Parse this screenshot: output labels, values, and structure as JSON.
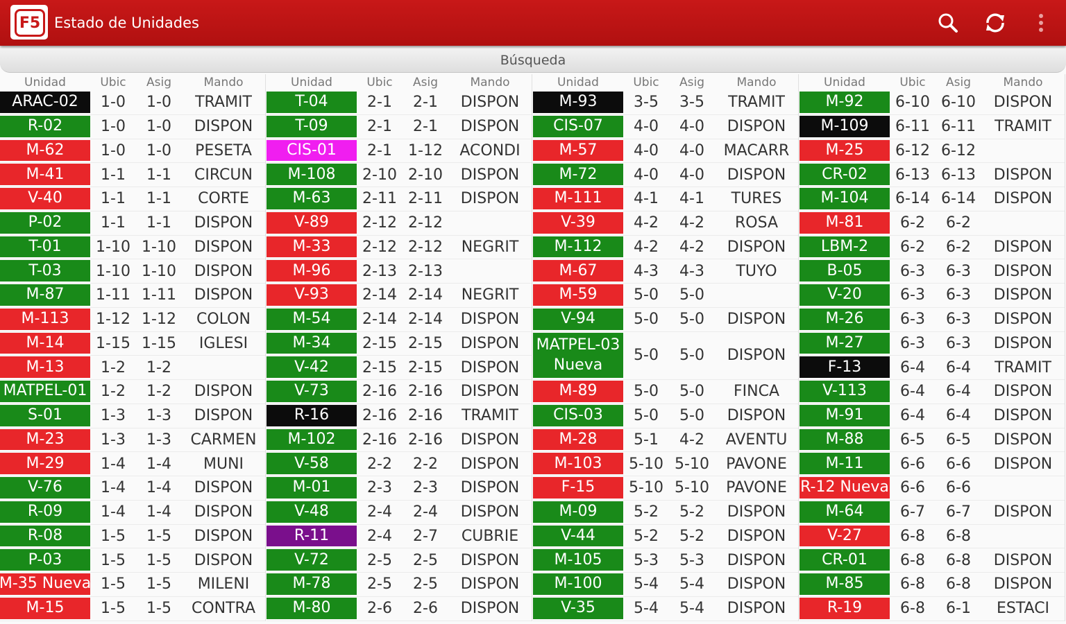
{
  "appbar": {
    "logo_text": "F5",
    "title": "Estado de Unidades",
    "icons": [
      "search-icon",
      "refresh-icon",
      "more-vert-icon"
    ]
  },
  "search": {
    "label": "Búsqueda"
  },
  "colors": {
    "green": "#198a19",
    "red": "#e8262a",
    "black": "#0c0c0c",
    "magenta": "#f01ef0",
    "purple": "#7a0f8c",
    "appbar": "#c81818"
  },
  "headers": {
    "unit": "Unidad",
    "ubic": "Ubic",
    "asig": "Asig",
    "mando": "Mando"
  },
  "columns": [
    [
      {
        "unit": "ARAC-02",
        "status": "black",
        "ubic": "1-0",
        "asig": "1-0",
        "mando": "TRAMIT"
      },
      {
        "unit": "R-02",
        "status": "green",
        "ubic": "1-0",
        "asig": "1-0",
        "mando": "DISPON"
      },
      {
        "unit": "M-62",
        "status": "red",
        "ubic": "1-0",
        "asig": "1-0",
        "mando": "PESETA"
      },
      {
        "unit": "M-41",
        "status": "red",
        "ubic": "1-1",
        "asig": "1-1",
        "mando": "CIRCUN"
      },
      {
        "unit": "V-40",
        "status": "red",
        "ubic": "1-1",
        "asig": "1-1",
        "mando": "CORTE"
      },
      {
        "unit": "P-02",
        "status": "green",
        "ubic": "1-1",
        "asig": "1-1",
        "mando": "DISPON"
      },
      {
        "unit": "T-01",
        "status": "green",
        "ubic": "1-10",
        "asig": "1-10",
        "mando": "DISPON"
      },
      {
        "unit": "T-03",
        "status": "green",
        "ubic": "1-10",
        "asig": "1-10",
        "mando": "DISPON"
      },
      {
        "unit": "M-87",
        "status": "green",
        "ubic": "1-11",
        "asig": "1-11",
        "mando": "DISPON"
      },
      {
        "unit": "M-113",
        "status": "red",
        "ubic": "1-12",
        "asig": "1-12",
        "mando": "COLON"
      },
      {
        "unit": "M-14",
        "status": "red",
        "ubic": "1-15",
        "asig": "1-15",
        "mando": "IGLESI"
      },
      {
        "unit": "M-13",
        "status": "red",
        "ubic": "1-2",
        "asig": "1-2",
        "mando": ""
      },
      {
        "unit": "MATPEL-01",
        "status": "green",
        "ubic": "1-2",
        "asig": "1-2",
        "mando": "DISPON"
      },
      {
        "unit": "S-01",
        "status": "green",
        "ubic": "1-3",
        "asig": "1-3",
        "mando": "DISPON"
      },
      {
        "unit": "M-23",
        "status": "red",
        "ubic": "1-3",
        "asig": "1-3",
        "mando": "CARMEN"
      },
      {
        "unit": "M-29",
        "status": "red",
        "ubic": "1-4",
        "asig": "1-4",
        "mando": "MUNI"
      },
      {
        "unit": "V-76",
        "status": "green",
        "ubic": "1-4",
        "asig": "1-4",
        "mando": "DISPON"
      },
      {
        "unit": "R-09",
        "status": "green",
        "ubic": "1-4",
        "asig": "1-4",
        "mando": "DISPON"
      },
      {
        "unit": "R-08",
        "status": "green",
        "ubic": "1-5",
        "asig": "1-5",
        "mando": "DISPON"
      },
      {
        "unit": "P-03",
        "status": "green",
        "ubic": "1-5",
        "asig": "1-5",
        "mando": "DISPON"
      },
      {
        "unit": "M-35 Nueva",
        "status": "red",
        "ubic": "1-5",
        "asig": "1-5",
        "mando": "MILENI"
      },
      {
        "unit": "M-15",
        "status": "red",
        "ubic": "1-5",
        "asig": "1-5",
        "mando": "CONTRA"
      }
    ],
    [
      {
        "unit": "T-04",
        "status": "green",
        "ubic": "2-1",
        "asig": "2-1",
        "mando": "DISPON"
      },
      {
        "unit": "T-09",
        "status": "green",
        "ubic": "2-1",
        "asig": "2-1",
        "mando": "DISPON"
      },
      {
        "unit": "CIS-01",
        "status": "magenta",
        "ubic": "2-1",
        "asig": "1-12",
        "mando": "ACONDI"
      },
      {
        "unit": "M-108",
        "status": "green",
        "ubic": "2-10",
        "asig": "2-10",
        "mando": "DISPON"
      },
      {
        "unit": "M-63",
        "status": "green",
        "ubic": "2-11",
        "asig": "2-11",
        "mando": "DISPON"
      },
      {
        "unit": "V-89",
        "status": "red",
        "ubic": "2-12",
        "asig": "2-12",
        "mando": ""
      },
      {
        "unit": "M-33",
        "status": "red",
        "ubic": "2-12",
        "asig": "2-12",
        "mando": "NEGRIT"
      },
      {
        "unit": "M-96",
        "status": "red",
        "ubic": "2-13",
        "asig": "2-13",
        "mando": ""
      },
      {
        "unit": "V-93",
        "status": "red",
        "ubic": "2-14",
        "asig": "2-14",
        "mando": "NEGRIT"
      },
      {
        "unit": "M-54",
        "status": "green",
        "ubic": "2-14",
        "asig": "2-14",
        "mando": "DISPON"
      },
      {
        "unit": "M-34",
        "status": "green",
        "ubic": "2-15",
        "asig": "2-15",
        "mando": "DISPON"
      },
      {
        "unit": "V-42",
        "status": "green",
        "ubic": "2-15",
        "asig": "2-15",
        "mando": "DISPON"
      },
      {
        "unit": "V-73",
        "status": "green",
        "ubic": "2-16",
        "asig": "2-16",
        "mando": "DISPON"
      },
      {
        "unit": "R-16",
        "status": "black",
        "ubic": "2-16",
        "asig": "2-16",
        "mando": "TRAMIT"
      },
      {
        "unit": "M-102",
        "status": "green",
        "ubic": "2-16",
        "asig": "2-16",
        "mando": "DISPON"
      },
      {
        "unit": "V-58",
        "status": "green",
        "ubic": "2-2",
        "asig": "2-2",
        "mando": "DISPON"
      },
      {
        "unit": "M-01",
        "status": "green",
        "ubic": "2-3",
        "asig": "2-3",
        "mando": "DISPON"
      },
      {
        "unit": "V-48",
        "status": "green",
        "ubic": "2-4",
        "asig": "2-4",
        "mando": "DISPON"
      },
      {
        "unit": "R-11",
        "status": "purple",
        "ubic": "2-4",
        "asig": "2-7",
        "mando": "CUBRIE"
      },
      {
        "unit": "V-72",
        "status": "green",
        "ubic": "2-5",
        "asig": "2-5",
        "mando": "DISPON"
      },
      {
        "unit": "M-78",
        "status": "green",
        "ubic": "2-5",
        "asig": "2-5",
        "mando": "DISPON"
      },
      {
        "unit": "M-80",
        "status": "green",
        "ubic": "2-6",
        "asig": "2-6",
        "mando": "DISPON"
      }
    ],
    [
      {
        "unit": "M-93",
        "status": "black",
        "ubic": "3-5",
        "asig": "3-5",
        "mando": "TRAMIT"
      },
      {
        "unit": "CIS-07",
        "status": "green",
        "ubic": "4-0",
        "asig": "4-0",
        "mando": "DISPON"
      },
      {
        "unit": "M-57",
        "status": "red",
        "ubic": "4-0",
        "asig": "4-0",
        "mando": "MACARR"
      },
      {
        "unit": "M-72",
        "status": "green",
        "ubic": "4-0",
        "asig": "4-0",
        "mando": "DISPON"
      },
      {
        "unit": "M-111",
        "status": "red",
        "ubic": "4-1",
        "asig": "4-1",
        "mando": "TURES"
      },
      {
        "unit": "V-39",
        "status": "red",
        "ubic": "4-2",
        "asig": "4-2",
        "mando": "ROSA"
      },
      {
        "unit": "M-112",
        "status": "green",
        "ubic": "4-2",
        "asig": "4-2",
        "mando": "DISPON"
      },
      {
        "unit": "M-67",
        "status": "red",
        "ubic": "4-3",
        "asig": "4-3",
        "mando": "TUYO"
      },
      {
        "unit": "M-59",
        "status": "red",
        "ubic": "5-0",
        "asig": "5-0",
        "mando": ""
      },
      {
        "unit": "V-94",
        "status": "green",
        "ubic": "5-0",
        "asig": "5-0",
        "mando": "DISPON"
      },
      {
        "unit": "MATPEL-03 Nueva",
        "status": "green",
        "ubic": "5-0",
        "asig": "5-0",
        "mando": "DISPON",
        "tall": true
      },
      {
        "unit": "M-89",
        "status": "red",
        "ubic": "5-0",
        "asig": "5-0",
        "mando": "FINCA"
      },
      {
        "unit": "CIS-03",
        "status": "green",
        "ubic": "5-0",
        "asig": "5-0",
        "mando": "DISPON"
      },
      {
        "unit": "M-28",
        "status": "red",
        "ubic": "5-1",
        "asig": "4-2",
        "mando": "AVENTU"
      },
      {
        "unit": "M-103",
        "status": "red",
        "ubic": "5-10",
        "asig": "5-10",
        "mando": "PAVONE"
      },
      {
        "unit": "F-15",
        "status": "red",
        "ubic": "5-10",
        "asig": "5-10",
        "mando": "PAVONE"
      },
      {
        "unit": "M-09",
        "status": "green",
        "ubic": "5-2",
        "asig": "5-2",
        "mando": "DISPON"
      },
      {
        "unit": "V-44",
        "status": "green",
        "ubic": "5-2",
        "asig": "5-2",
        "mando": "DISPON"
      },
      {
        "unit": "M-105",
        "status": "green",
        "ubic": "5-3",
        "asig": "5-3",
        "mando": "DISPON"
      },
      {
        "unit": "M-100",
        "status": "green",
        "ubic": "5-4",
        "asig": "5-4",
        "mando": "DISPON"
      },
      {
        "unit": "V-35",
        "status": "green",
        "ubic": "5-4",
        "asig": "5-4",
        "mando": "DISPON"
      }
    ],
    [
      {
        "unit": "M-92",
        "status": "green",
        "ubic": "6-10",
        "asig": "6-10",
        "mando": "DISPON"
      },
      {
        "unit": "M-109",
        "status": "black",
        "ubic": "6-11",
        "asig": "6-11",
        "mando": "TRAMIT"
      },
      {
        "unit": "M-25",
        "status": "red",
        "ubic": "6-12",
        "asig": "6-12",
        "mando": ""
      },
      {
        "unit": "CR-02",
        "status": "green",
        "ubic": "6-13",
        "asig": "6-13",
        "mando": "DISPON"
      },
      {
        "unit": "M-104",
        "status": "green",
        "ubic": "6-14",
        "asig": "6-14",
        "mando": "DISPON"
      },
      {
        "unit": "M-81",
        "status": "red",
        "ubic": "6-2",
        "asig": "6-2",
        "mando": ""
      },
      {
        "unit": "LBM-2",
        "status": "green",
        "ubic": "6-2",
        "asig": "6-2",
        "mando": "DISPON"
      },
      {
        "unit": "B-05",
        "status": "green",
        "ubic": "6-3",
        "asig": "6-3",
        "mando": "DISPON"
      },
      {
        "unit": "V-20",
        "status": "green",
        "ubic": "6-3",
        "asig": "6-3",
        "mando": "DISPON"
      },
      {
        "unit": "M-26",
        "status": "green",
        "ubic": "6-3",
        "asig": "6-3",
        "mando": "DISPON"
      },
      {
        "unit": "M-27",
        "status": "green",
        "ubic": "6-3",
        "asig": "6-3",
        "mando": "DISPON"
      },
      {
        "unit": "F-13",
        "status": "black",
        "ubic": "6-4",
        "asig": "6-4",
        "mando": "TRAMIT"
      },
      {
        "unit": "V-113",
        "status": "green",
        "ubic": "6-4",
        "asig": "6-4",
        "mando": "DISPON"
      },
      {
        "unit": "M-91",
        "status": "green",
        "ubic": "6-4",
        "asig": "6-4",
        "mando": "DISPON"
      },
      {
        "unit": "M-88",
        "status": "green",
        "ubic": "6-5",
        "asig": "6-5",
        "mando": "DISPON"
      },
      {
        "unit": "M-11",
        "status": "green",
        "ubic": "6-6",
        "asig": "6-6",
        "mando": "DISPON"
      },
      {
        "unit": "R-12 Nueva",
        "status": "red",
        "ubic": "6-6",
        "asig": "6-6",
        "mando": ""
      },
      {
        "unit": "M-64",
        "status": "green",
        "ubic": "6-7",
        "asig": "6-7",
        "mando": "DISPON"
      },
      {
        "unit": "V-27",
        "status": "red",
        "ubic": "6-8",
        "asig": "6-8",
        "mando": ""
      },
      {
        "unit": "CR-01",
        "status": "green",
        "ubic": "6-8",
        "asig": "6-8",
        "mando": "DISPON"
      },
      {
        "unit": "M-85",
        "status": "green",
        "ubic": "6-8",
        "asig": "6-8",
        "mando": "DISPON"
      },
      {
        "unit": "R-19",
        "status": "red",
        "ubic": "6-8",
        "asig": "6-1",
        "mando": "ESTACI"
      }
    ]
  ]
}
